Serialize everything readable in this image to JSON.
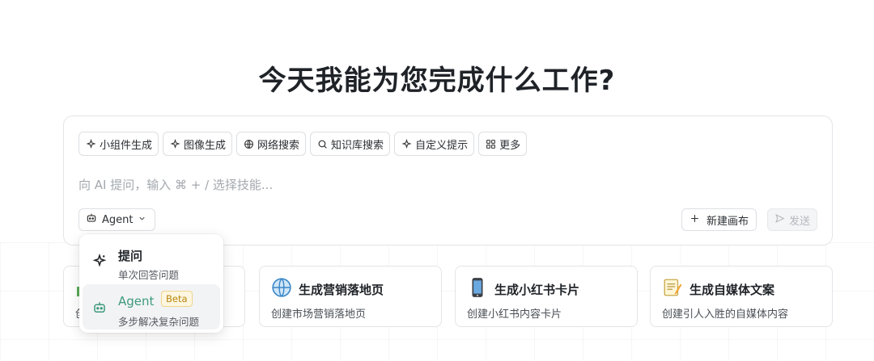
{
  "page": {
    "title": "今天我能为您完成什么工作?"
  },
  "composer": {
    "chips": [
      {
        "label": "小组件生成",
        "icon": "sparkle-icon"
      },
      {
        "label": "图像生成",
        "icon": "sparkle-icon"
      },
      {
        "label": "网络搜索",
        "icon": "globe-icon"
      },
      {
        "label": "知识库搜索",
        "icon": "search-icon"
      },
      {
        "label": "自定义提示",
        "icon": "sparkle-icon"
      },
      {
        "label": "更多",
        "icon": "grid-icon"
      }
    ],
    "input": {
      "value": "",
      "placeholder": "向 AI 提问，输入 ⌘ + / 选择技能..."
    },
    "mode_label": "Agent",
    "new_canvas_label": "新建画布",
    "send_label": "发送"
  },
  "dropdown": {
    "items": [
      {
        "title": "提问",
        "desc": "单次回答问题",
        "icon": "sparkle-icon"
      },
      {
        "title": "Agent",
        "desc": "多步解决复杂问题",
        "icon": "robot-icon",
        "badge": "Beta"
      }
    ]
  },
  "cards": [
    {
      "title": "",
      "desc": "创",
      "icon": "chart-icon"
    },
    {
      "title": "生成营销落地页",
      "desc": "创建市场营销落地页",
      "icon": "globe-icon"
    },
    {
      "title": "生成小红书卡片",
      "desc": "创建小红书内容卡片",
      "icon": "phone-icon"
    },
    {
      "title": "生成自媒体文案",
      "desc": "创建引人入胜的自媒体内容",
      "icon": "memo-icon"
    }
  ],
  "colors": {
    "accent": "#3d9a7a",
    "badge_bg": "#fdf6e0",
    "badge_text": "#b8860b"
  }
}
